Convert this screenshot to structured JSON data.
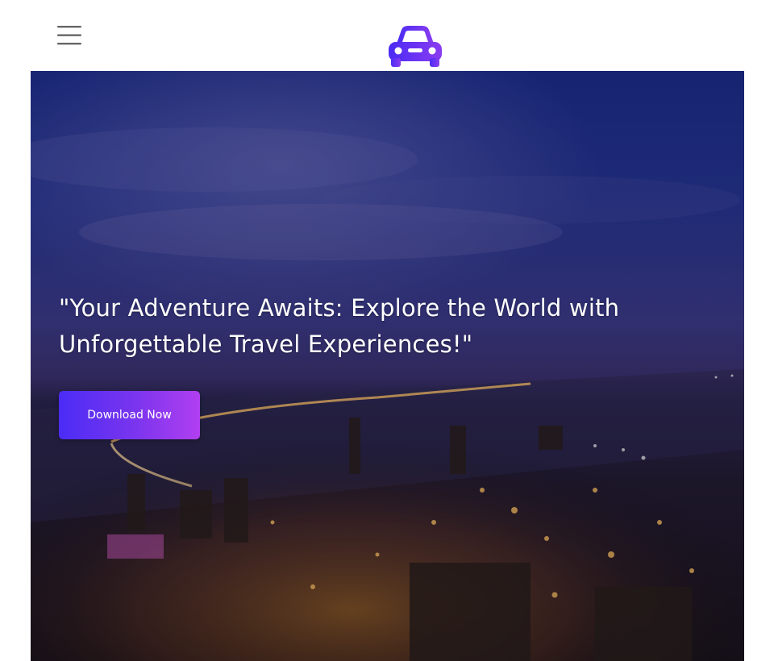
{
  "header": {
    "menu_icon": "hamburger-menu-icon",
    "logo_icon": "car-icon",
    "logo_gradient": [
      "#4b2cf5",
      "#8a3cf0"
    ]
  },
  "hero": {
    "title_line1": "\"Your Adventure Awaits: Explore the World with",
    "title_line2": "Unforgettable Travel Experiences!\"",
    "cta_label": "Download Now",
    "cta_gradient": [
      "#4b2cf5",
      "#b13ff0"
    ],
    "background": "night-city-skyline-image"
  }
}
